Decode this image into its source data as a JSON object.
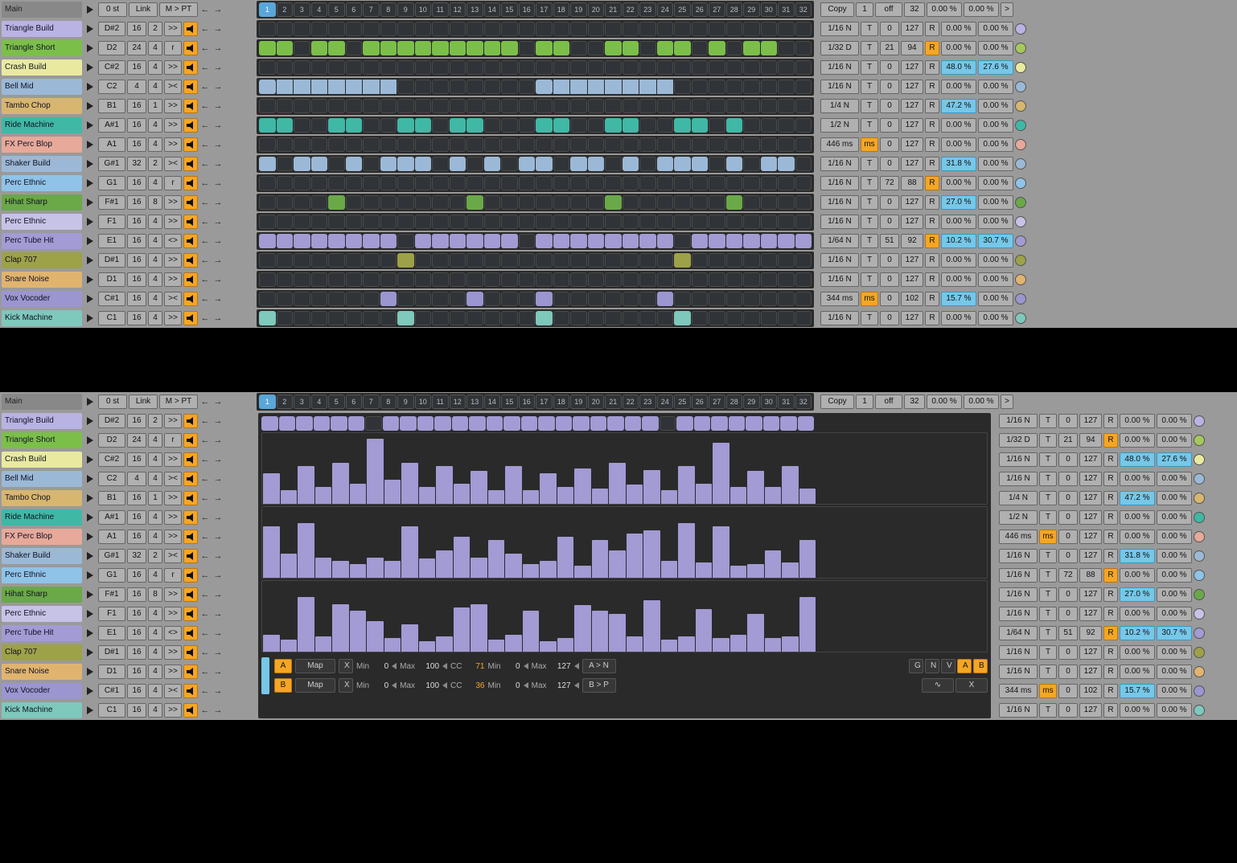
{
  "header": {
    "label": "Main",
    "ost": "0 st",
    "link": "Link",
    "mpt": "M > PT",
    "copy": "Copy",
    "one": "1",
    "off": "off",
    "steps": "32",
    "p1": "0.00 %",
    "p2": "0.00 %",
    "gt": ">"
  },
  "step_numbers": [
    1,
    2,
    3,
    4,
    5,
    6,
    7,
    8,
    9,
    10,
    11,
    12,
    13,
    14,
    15,
    16,
    17,
    18,
    19,
    20,
    21,
    22,
    23,
    24,
    25,
    26,
    27,
    28,
    29,
    30,
    31,
    32
  ],
  "tracks": [
    {
      "name": "Triangle Build",
      "color": "#b9b3e3",
      "note": "D#2",
      "len": "16",
      "div": "2",
      "mode": ">>",
      "rate": "1/16 N",
      "t": "T",
      "lo": "0",
      "hi": "127",
      "r": "R",
      "rY": false,
      "p1": "0.00 %",
      "p2": "0.00 %",
      "hl1": false,
      "hl2": false,
      "dot": "#b9b3e3",
      "steps": []
    },
    {
      "name": "Triangle Short",
      "color": "#7bbf49",
      "note": "D2",
      "len": "24",
      "div": "4",
      "mode": "r",
      "rate": "1/32 D",
      "t": "T",
      "lo": "21",
      "hi": "94",
      "r": "R",
      "rY": true,
      "p1": "0.00 %",
      "p2": "0.00 %",
      "hl1": false,
      "hl2": false,
      "dot": "#a6c85b",
      "steps": [
        1,
        2,
        4,
        5,
        7,
        8,
        9,
        10,
        11,
        12,
        13,
        14,
        15,
        17,
        18,
        21,
        22,
        24,
        25,
        27,
        29,
        30
      ]
    },
    {
      "name": "Crash Build",
      "color": "#e9eaa0",
      "note": "C#2",
      "len": "16",
      "div": "4",
      "mode": ">>",
      "rate": "1/16 N",
      "t": "T",
      "lo": "0",
      "hi": "127",
      "r": "R",
      "rY": false,
      "p1": "48.0 %",
      "p2": "27.6 %",
      "hl1": true,
      "hl2": true,
      "dot": "#e9eaa0",
      "steps": []
    },
    {
      "name": "Bell Mid",
      "color": "#9bb9d6",
      "note": "C2",
      "len": "4",
      "div": "4",
      "mode": "><",
      "rate": "1/16 N",
      "t": "T",
      "lo": "0",
      "hi": "127",
      "r": "R",
      "rY": false,
      "p1": "0.00 %",
      "p2": "0.00 %",
      "hl1": false,
      "hl2": false,
      "dot": "#9bb9d6",
      "steps": [],
      "long": [
        [
          1,
          8
        ],
        [
          17,
          24
        ]
      ]
    },
    {
      "name": "Tambo Chop",
      "color": "#d7b66f",
      "note": "B1",
      "len": "16",
      "div": "1",
      "mode": ">>",
      "rate": "1/4 N",
      "t": "T",
      "lo": "0",
      "hi": "127",
      "r": "R",
      "rY": false,
      "p1": "47.2 %",
      "p2": "0.00 %",
      "hl1": true,
      "hl2": false,
      "dot": "#d7b66f",
      "steps": []
    },
    {
      "name": "Ride Machine",
      "color": "#3fb8a5",
      "note": "A#1",
      "len": "16",
      "div": "4",
      "mode": ">>",
      "rate": "1/2 N",
      "t": "T",
      "lo": "0",
      "hi": "127",
      "r": "R",
      "rY": false,
      "p1": "0.00 %",
      "p2": "0.00 %",
      "hl1": false,
      "hl2": false,
      "dot": "#3fb8a5",
      "steps": [
        1,
        2,
        5,
        6,
        9,
        10,
        12,
        13,
        17,
        18,
        21,
        22,
        25,
        26,
        28
      ]
    },
    {
      "name": "FX Perc Blop",
      "color": "#e6a99a",
      "note": "A1",
      "len": "16",
      "div": "4",
      "mode": ">>",
      "rate": "446 ms",
      "t": "ms",
      "tY": true,
      "lo": "0",
      "hi": "127",
      "r": "R",
      "rY": false,
      "p1": "0.00 %",
      "p2": "0.00 %",
      "hl1": false,
      "hl2": false,
      "dot": "#e6a99a",
      "steps": []
    },
    {
      "name": "Shaker Build",
      "color": "#9bb9d6",
      "note": "G#1",
      "len": "32",
      "div": "2",
      "mode": "><",
      "rate": "1/16 N",
      "t": "T",
      "lo": "0",
      "hi": "127",
      "r": "R",
      "rY": false,
      "p1": "31.8 %",
      "p2": "0.00 %",
      "hl1": true,
      "hl2": false,
      "dot": "#9bb9d6",
      "steps": [
        1,
        3,
        4,
        6,
        8,
        9,
        10,
        12,
        14,
        16,
        17,
        19,
        20,
        22,
        24,
        25,
        26,
        28,
        30,
        31
      ]
    },
    {
      "name": "Perc Ethnic",
      "color": "#8fc3e8",
      "note": "G1",
      "len": "16",
      "div": "4",
      "mode": "r",
      "rate": "1/16 N",
      "t": "T",
      "lo": "72",
      "hi": "88",
      "r": "R",
      "rY": true,
      "p1": "0.00 %",
      "p2": "0.00 %",
      "hl1": false,
      "hl2": false,
      "dot": "#8fc3e8",
      "steps": []
    },
    {
      "name": "Hihat Sharp",
      "color": "#6aa848",
      "note": "F#1",
      "len": "16",
      "div": "8",
      "mode": ">>",
      "rate": "1/16 N",
      "t": "T",
      "lo": "0",
      "hi": "127",
      "r": "R",
      "rY": false,
      "p1": "27.0 %",
      "p2": "0.00 %",
      "hl1": true,
      "hl2": false,
      "dot": "#6aa848",
      "steps": [
        5,
        13,
        21,
        28
      ]
    },
    {
      "name": "Perc Ethnic",
      "color": "#c7c3e6",
      "note": "F1",
      "len": "16",
      "div": "4",
      "mode": ">>",
      "rate": "1/16 N",
      "t": "T",
      "lo": "0",
      "hi": "127",
      "r": "R",
      "rY": false,
      "p1": "0.00 %",
      "p2": "0.00 %",
      "hl1": false,
      "hl2": false,
      "dot": "#c7c3e6",
      "steps": []
    },
    {
      "name": "Perc Tube Hit",
      "color": "#a29bd4",
      "note": "E1",
      "len": "16",
      "div": "4",
      "mode": "<>",
      "rate": "1/64 N",
      "t": "T",
      "lo": "51",
      "hi": "92",
      "r": "R",
      "rY": true,
      "p1": "10.2 %",
      "p2": "30.7 %",
      "hl1": true,
      "hl2": true,
      "dot": "#a29bd4",
      "steps": [
        1,
        2,
        3,
        4,
        5,
        6,
        7,
        8,
        10,
        11,
        12,
        13,
        14,
        15,
        17,
        18,
        19,
        20,
        21,
        22,
        23,
        24,
        26,
        27,
        28,
        29,
        30,
        31,
        32
      ]
    },
    {
      "name": "Clap 707",
      "color": "#9da148",
      "note": "D#1",
      "len": "16",
      "div": "4",
      "mode": ">>",
      "rate": "1/16 N",
      "t": "T",
      "lo": "0",
      "hi": "127",
      "r": "R",
      "rY": false,
      "p1": "0.00 %",
      "p2": "0.00 %",
      "hl1": false,
      "hl2": false,
      "dot": "#9da148",
      "steps": [
        9,
        25
      ]
    },
    {
      "name": "Snare Noise",
      "color": "#e0b46f",
      "note": "D1",
      "len": "16",
      "div": "4",
      "mode": ">>",
      "rate": "1/16 N",
      "t": "T",
      "lo": "0",
      "hi": "127",
      "r": "R",
      "rY": false,
      "p1": "0.00 %",
      "p2": "0.00 %",
      "hl1": false,
      "hl2": false,
      "dot": "#e0b46f",
      "steps": []
    },
    {
      "name": "Vox Vocoder",
      "color": "#9b95d0",
      "note": "C#1",
      "len": "16",
      "div": "4",
      "mode": "><",
      "rate": "344 ms",
      "t": "ms",
      "tY": true,
      "lo": "0",
      "hi": "102",
      "r": "R",
      "rY": false,
      "p1": "15.7 %",
      "p2": "0.00 %",
      "hl1": true,
      "hl2": false,
      "dot": "#9b95d0",
      "steps": [
        8,
        13,
        17,
        24
      ]
    },
    {
      "name": "Kick Machine",
      "color": "#7ec8bc",
      "note": "C1",
      "len": "16",
      "div": "4",
      "mode": ">>",
      "rate": "1/16 N",
      "t": "T",
      "lo": "0",
      "hi": "127",
      "r": "R",
      "rY": false,
      "p1": "0.00 %",
      "p2": "0.00 %",
      "hl1": false,
      "hl2": false,
      "dot": "#7ec8bc",
      "steps": [
        1,
        9,
        17,
        25
      ]
    }
  ],
  "bottom": {
    "notes_off": [
      7,
      24
    ],
    "vel_rows": [
      [
        45,
        20,
        55,
        25,
        60,
        30,
        95,
        35,
        60,
        25,
        55,
        30,
        48,
        20,
        55,
        20,
        45,
        25,
        52,
        22,
        60,
        28,
        50,
        20,
        55,
        30,
        90,
        25,
        48,
        25,
        55,
        22
      ],
      [
        75,
        35,
        80,
        30,
        25,
        20,
        30,
        25,
        75,
        28,
        40,
        60,
        30,
        55,
        35,
        20,
        25,
        60,
        18,
        55,
        40,
        65,
        70,
        25,
        80,
        22,
        75,
        18,
        20,
        40,
        22,
        55
      ],
      [
        25,
        18,
        80,
        22,
        70,
        60,
        45,
        20,
        40,
        15,
        22,
        65,
        70,
        18,
        25,
        60,
        15,
        20,
        68,
        60,
        55,
        22,
        75,
        18,
        22,
        62,
        20,
        25,
        55,
        20,
        22,
        80
      ]
    ],
    "ctrl": {
      "A": {
        "label": "A",
        "map": "Map",
        "x": "X",
        "minL": "Min",
        "min": "0",
        "maxL": "Max",
        "max": "100",
        "ccL": "CC",
        "cc": "71",
        "min2L": "Min",
        "min2": "0",
        "max2L": "Max",
        "max2": "127",
        "route": "A > N"
      },
      "B": {
        "label": "B",
        "map": "Map",
        "x": "X",
        "minL": "Min",
        "min": "0",
        "maxL": "Max",
        "max": "100",
        "ccL": "CC",
        "cc": "36",
        "min2L": "Min",
        "min2": "0",
        "max2L": "Max",
        "max2": "127",
        "route": "B > P"
      },
      "mode_btns": [
        "G",
        "N",
        "V",
        "A",
        "B"
      ],
      "extra": [
        "∿",
        "X"
      ]
    }
  }
}
